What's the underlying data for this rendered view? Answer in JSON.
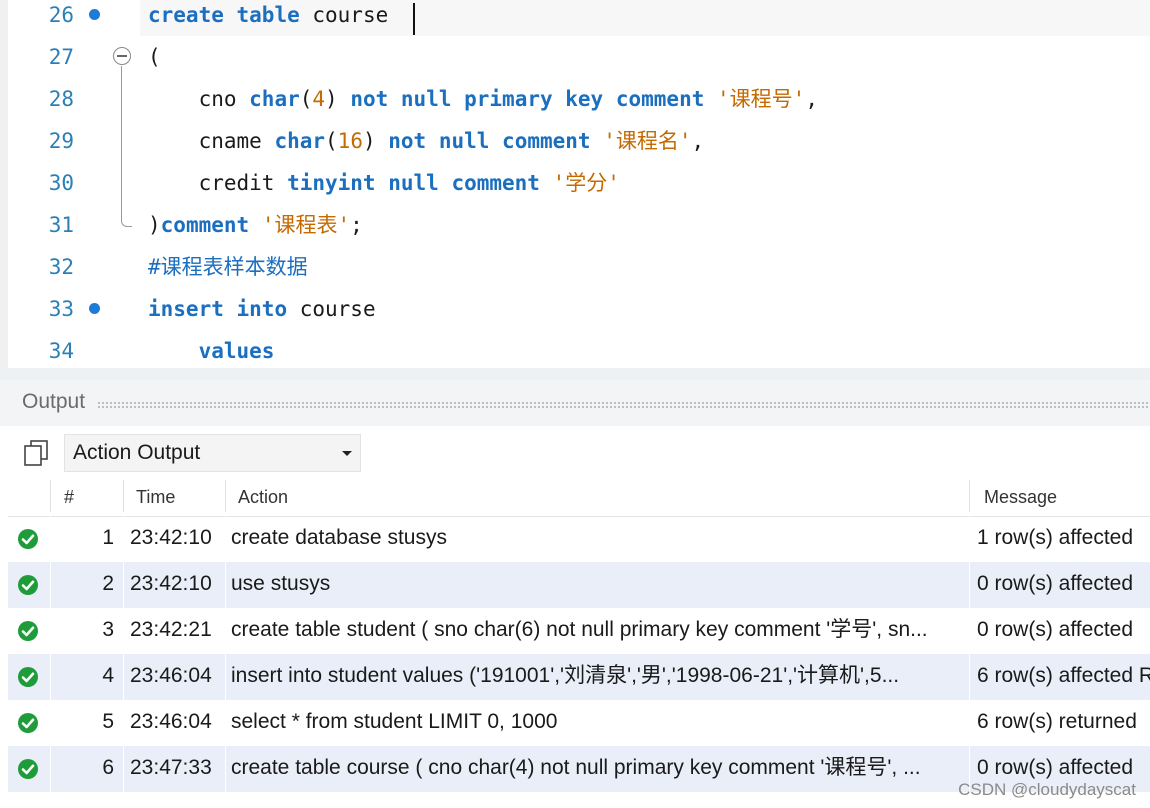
{
  "editor": {
    "lines": [
      {
        "n": "26",
        "bp": true,
        "tokens": [
          [
            "kw",
            "create"
          ],
          [
            "",
            "&nbsp;"
          ],
          [
            "kw",
            "table"
          ],
          [
            "",
            "&nbsp;course"
          ]
        ]
      },
      {
        "n": "27",
        "bp": false,
        "tokens": [
          [
            "",
            "("
          ]
        ]
      },
      {
        "n": "28",
        "bp": false,
        "tokens": [
          [
            "",
            "&nbsp;&nbsp;&nbsp;&nbsp;cno "
          ],
          [
            "kw",
            "char"
          ],
          [
            "",
            "("
          ],
          [
            "num",
            "4"
          ],
          [
            "",
            ") "
          ],
          [
            "kw",
            "not null primary key comment"
          ],
          [
            "",
            "&nbsp;"
          ],
          [
            "str",
            "'课程号'"
          ],
          [
            "",
            ","
          ]
        ]
      },
      {
        "n": "29",
        "bp": false,
        "tokens": [
          [
            "",
            "&nbsp;&nbsp;&nbsp;&nbsp;cname "
          ],
          [
            "kw",
            "char"
          ],
          [
            "",
            "("
          ],
          [
            "num",
            "16"
          ],
          [
            "",
            ") "
          ],
          [
            "kw",
            "not null comment"
          ],
          [
            "",
            "&nbsp;"
          ],
          [
            "str",
            "'课程名'"
          ],
          [
            "",
            ","
          ]
        ]
      },
      {
        "n": "30",
        "bp": false,
        "tokens": [
          [
            "",
            "&nbsp;&nbsp;&nbsp;&nbsp;credit "
          ],
          [
            "kw",
            "tinyint null comment"
          ],
          [
            "",
            "&nbsp;"
          ],
          [
            "str",
            "'学分'"
          ]
        ]
      },
      {
        "n": "31",
        "bp": false,
        "tokens": [
          [
            "",
            ")"
          ],
          [
            "kw",
            "comment"
          ],
          [
            "",
            "&nbsp;"
          ],
          [
            "str",
            "'课程表'"
          ],
          [
            "",
            ";"
          ]
        ]
      },
      {
        "n": "32",
        "bp": false,
        "tokens": [
          [
            "cmt",
            "#课程表样本数据"
          ]
        ]
      },
      {
        "n": "33",
        "bp": true,
        "tokens": [
          [
            "kw",
            "insert"
          ],
          [
            "",
            "&nbsp;"
          ],
          [
            "kw",
            "into"
          ],
          [
            "",
            "&nbsp;course"
          ]
        ]
      },
      {
        "n": "34",
        "bp": false,
        "tokens": [
          [
            "",
            "&nbsp;&nbsp;&nbsp;&nbsp;"
          ],
          [
            "kw",
            "values"
          ]
        ]
      }
    ]
  },
  "output": {
    "title": "Output",
    "dropdown_value": "Action Output",
    "columns": {
      "num": "#",
      "time": "Time",
      "action": "Action",
      "message": "Message"
    },
    "rows": [
      {
        "num": "1",
        "time": "23:42:10",
        "action": "create database stusys",
        "message": "1 row(s) affected"
      },
      {
        "num": "2",
        "time": "23:42:10",
        "action": "use stusys",
        "message": "0 row(s) affected"
      },
      {
        "num": "3",
        "time": "23:42:21",
        "action": "create table student ( sno char(6) not null primary key comment '学号',     sn...",
        "message": "0 row(s) affected"
      },
      {
        "num": "4",
        "time": "23:46:04",
        "action": "insert into student values      ('191001','刘清泉','男','1998-06-21','计算机',5...",
        "message": "6 row(s) affected R"
      },
      {
        "num": "5",
        "time": "23:46:04",
        "action": "select * from student LIMIT 0, 1000",
        "message": "6 row(s) returned"
      },
      {
        "num": "6",
        "time": "23:47:33",
        "action": "create table course ( cno char(4) not null primary key comment '课程号',     ...",
        "message": "0 row(s) affected"
      }
    ]
  },
  "watermark": "CSDN @cloudydayscat",
  "colors": {
    "keyword": "#1c6fbf",
    "string": "#c56a00",
    "ok": "#1f9c3a",
    "alt_row": "#e9eef8"
  }
}
